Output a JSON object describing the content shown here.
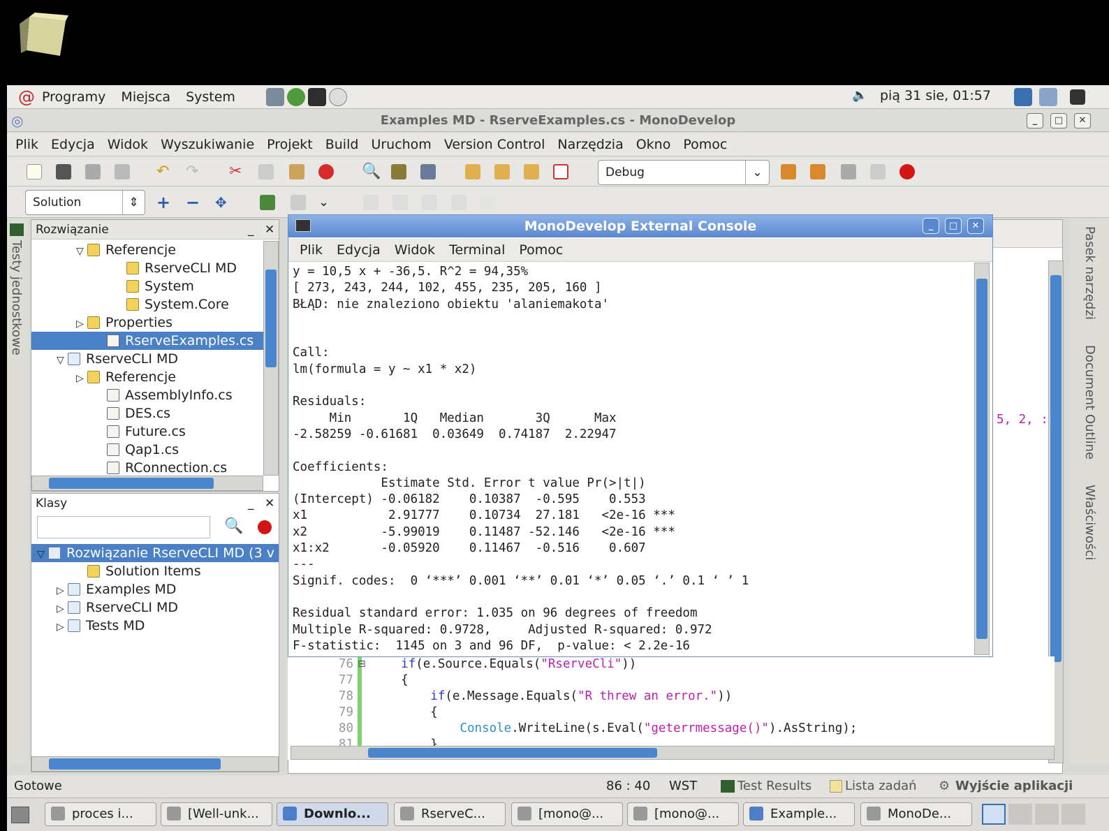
{
  "panel": {
    "menus": [
      "Programy",
      "Miejsca",
      "System"
    ],
    "clock": "pią 31 sie, 01:57"
  },
  "window": {
    "title": "Examples MD - RserveExamples.cs - MonoDevelop"
  },
  "menubar": [
    "Plik",
    "Edycja",
    "Widok",
    "Wyszukiwanie",
    "Projekt",
    "Build",
    "Uruchom",
    "Version Control",
    "Narzędzia",
    "Okno",
    "Pomoc"
  ],
  "toolbar": {
    "config": "Debug",
    "solution_combo": "Solution"
  },
  "left_strip": "Testy jednostkowe",
  "solution_panel": {
    "title": "Rozwiązanie",
    "items": [
      {
        "label": "Referencje",
        "indent": 2,
        "expander": "open",
        "icon": "ref"
      },
      {
        "label": "RserveCLI MD",
        "indent": 4,
        "expander": "",
        "icon": "ref"
      },
      {
        "label": "System",
        "indent": 4,
        "expander": "",
        "icon": "ref"
      },
      {
        "label": "System.Core",
        "indent": 4,
        "expander": "",
        "icon": "ref"
      },
      {
        "label": "Properties",
        "indent": 2,
        "expander": "closed",
        "icon": "folder"
      },
      {
        "label": "RserveExamples.cs",
        "indent": 3,
        "expander": "",
        "icon": "file",
        "selected": true
      },
      {
        "label": "RserveCLI MD",
        "indent": 1,
        "expander": "open",
        "icon": "proj"
      },
      {
        "label": "Referencje",
        "indent": 2,
        "expander": "closed",
        "icon": "ref"
      },
      {
        "label": "AssemblyInfo.cs",
        "indent": 3,
        "expander": "",
        "icon": "file"
      },
      {
        "label": "DES.cs",
        "indent": 3,
        "expander": "",
        "icon": "file"
      },
      {
        "label": "Future.cs",
        "indent": 3,
        "expander": "",
        "icon": "file"
      },
      {
        "label": "Qap1.cs",
        "indent": 3,
        "expander": "",
        "icon": "file"
      },
      {
        "label": "RConnection.cs",
        "indent": 3,
        "expander": "",
        "icon": "file"
      }
    ]
  },
  "classes_panel": {
    "title": "Klasy",
    "items": [
      {
        "label": "Rozwiązanie RserveCLI MD (3 v",
        "indent": 0,
        "expander": "open",
        "selected": true
      },
      {
        "label": "Solution Items",
        "indent": 2,
        "expander": ""
      },
      {
        "label": "Examples MD",
        "indent": 1,
        "expander": "closed"
      },
      {
        "label": "RserveCLI MD",
        "indent": 1,
        "expander": "closed"
      },
      {
        "label": "Tests MD",
        "indent": 1,
        "expander": "closed"
      }
    ]
  },
  "console": {
    "title": "MonoDevelop External Console",
    "menus": [
      "Plik",
      "Edycja",
      "Widok",
      "Terminal",
      "Pomoc"
    ],
    "lines": [
      "y = 10,5 x + -36,5. R^2 = 94,35%",
      "[ 273, 243, 244, 102, 455, 235, 205, 160 ]",
      "BŁĄD: nie znaleziono obiektu 'alaniemakota'",
      "",
      "",
      "Call:",
      "lm(formula = y ~ x1 * x2)",
      "",
      "Residuals:",
      "     Min       1Q   Median       3Q      Max ",
      "-2.58259 -0.61681  0.03649  0.74187  2.22947 ",
      "",
      "Coefficients:",
      "            Estimate Std. Error t value Pr(>|t|)    ",
      "(Intercept) -0.06182    0.10387  -0.595    0.553    ",
      "x1           2.91777    0.10734  27.181   <2e-16 ***",
      "x2          -5.99019    0.11487 -52.146   <2e-16 ***",
      "x1:x2       -0.05920    0.11467  -0.516    0.607    ",
      "---",
      "Signif. codes:  0 ‘***’ 0.001 ‘**’ 0.01 ‘*’ 0.05 ‘.’ 0.1 ‘ ’ 1 ",
      "",
      "Residual standard error: 1.035 on 96 degrees of freedom",
      "Multiple R-squared: 0.9728,     Adjusted R-squared: 0.972 ",
      "F-statistic:  1145 on 3 and 96 DF,  p-value: < 2.2e-16 "
    ]
  },
  "editor": {
    "partial_text": "5, 2, :",
    "lines": [
      {
        "num": "76",
        "indent": "    ",
        "kw": "if",
        "pre": "(e.Source.Equals(",
        "str": "\"RserveCli\"",
        "post": "))",
        "cls": ""
      },
      {
        "num": "77",
        "indent": "    ",
        "kw": "",
        "pre": "{",
        "str": "",
        "post": "",
        "cls": ""
      },
      {
        "num": "78",
        "indent": "        ",
        "kw": "if",
        "pre": "(e.Message.Equals(",
        "str": "\"R threw an error.\"",
        "post": "))",
        "cls": ""
      },
      {
        "num": "79",
        "indent": "        ",
        "kw": "",
        "pre": "{",
        "str": "",
        "post": "",
        "cls": ""
      },
      {
        "num": "80",
        "indent": "            ",
        "kw": "",
        "cls": "Console",
        "pre": ".WriteLine(s.Eval(",
        "str": "\"geterrmessage()\"",
        "post": ").AsString);"
      },
      {
        "num": "81",
        "indent": "        ",
        "kw": "",
        "pre": "}",
        "str": "",
        "post": "",
        "cls": ""
      }
    ]
  },
  "right_strip": [
    "Pasek narzędzi",
    "Document Outline",
    "Właściwości"
  ],
  "statusbar": {
    "status": "Gotowe",
    "position": "86 : 40",
    "mode": "WST",
    "pads": [
      "Test Results",
      "Lista zadań",
      "Wyjście aplikacji"
    ]
  },
  "taskbar": [
    "proces i...",
    "[Well-unk...",
    "Downlo...",
    "RserveC...",
    "[mono@...",
    "[mono@...",
    "Example...",
    "MonoDe..."
  ]
}
